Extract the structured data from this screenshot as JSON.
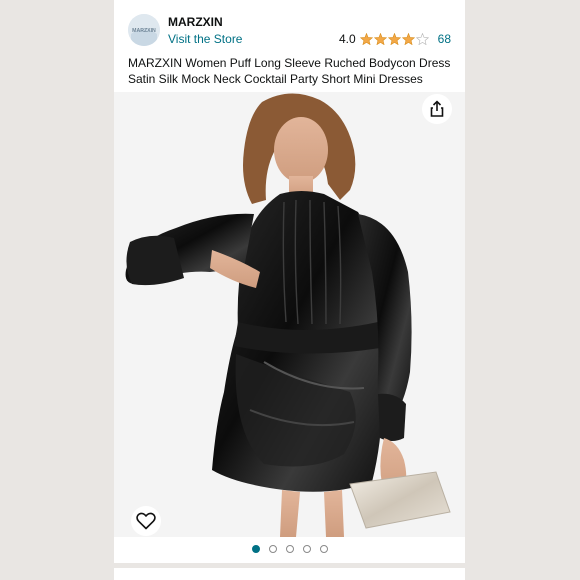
{
  "brand": {
    "logo_text": "MARZXIN",
    "name": "MARZXIN",
    "store_link": "Visit the Store"
  },
  "rating": {
    "value": "4.0",
    "stars": 4,
    "count": "68",
    "star_color": "#f3a847"
  },
  "product": {
    "title": "MARZXIN Women Puff Long Sleeve Ruched Bodycon Dress Satin Silk Mock Neck Cocktail Party Short Mini Dresses"
  },
  "gallery": {
    "image_count": 5,
    "active_index": 0
  },
  "icons": {
    "share": "share-icon",
    "wishlist": "heart-icon"
  },
  "colors": {
    "link": "#007185",
    "text": "#0f1111",
    "star": "#f3a847"
  }
}
